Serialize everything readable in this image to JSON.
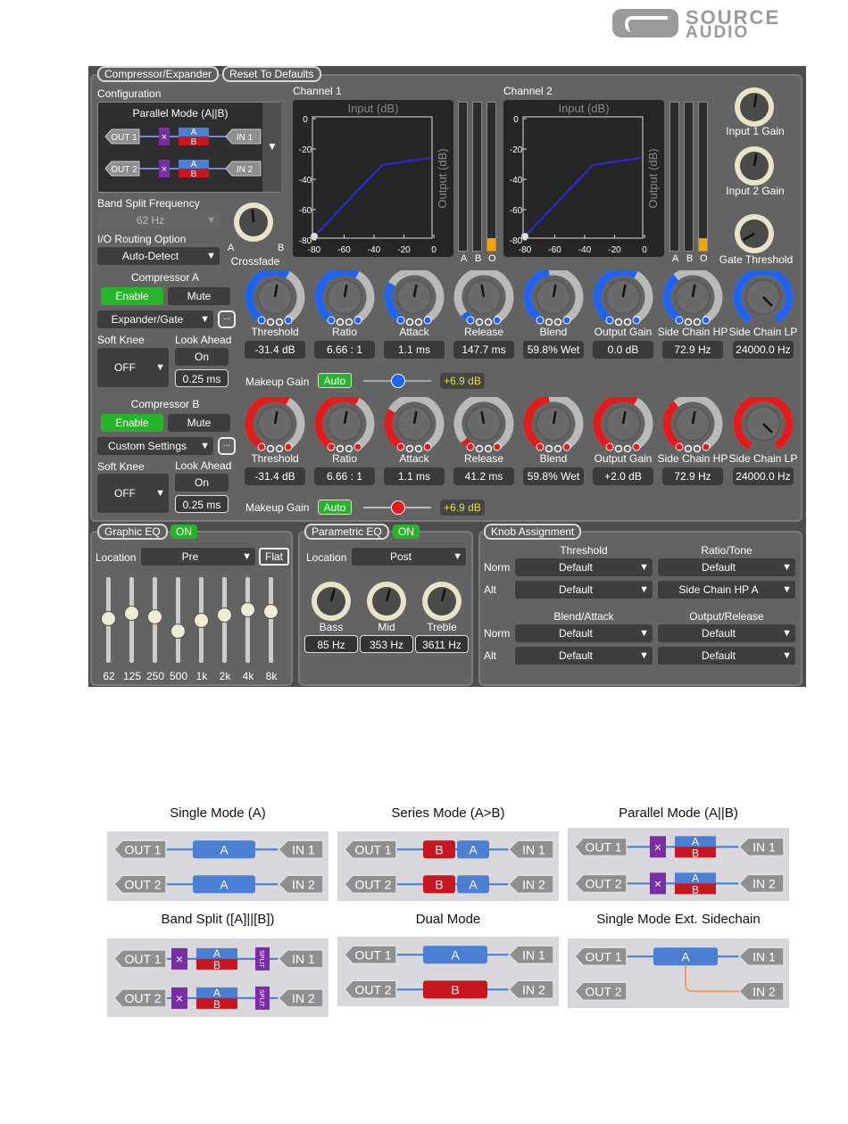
{
  "logo": {
    "line1": "SOURCE",
    "line2": "AUDIO"
  },
  "header": {
    "tab": "Compressor/Expander",
    "reset": "Reset To Defaults"
  },
  "config": {
    "label": "Configuration",
    "mode": "Parallel Mode (A||B)",
    "out1": "OUT 1",
    "out2": "OUT 2",
    "in1": "IN 1",
    "in2": "IN 2",
    "a": "A",
    "b": "B",
    "x": "×"
  },
  "bandsplit": {
    "label": "Band Split Frequency",
    "value": "62 Hz"
  },
  "crossfade": {
    "label": "Crossfade",
    "a": "A",
    "b": "B"
  },
  "routing": {
    "label": "I/O Routing Option",
    "value": "Auto-Detect"
  },
  "channels": [
    {
      "label": "Channel 1",
      "input": "Input (dB)",
      "output": "Output (dB)",
      "yt": [
        "0",
        "-20",
        "-40",
        "-60",
        "-80"
      ],
      "xt": [
        "-80",
        "-60",
        "-40",
        "-20",
        "0"
      ],
      "meters": [
        "A",
        "B",
        "O"
      ]
    },
    {
      "label": "Channel 2",
      "input": "Input (dB)",
      "output": "Output (dB)",
      "yt": [
        "0",
        "-20",
        "-40",
        "-60",
        "-80"
      ],
      "xt": [
        "-80",
        "-60",
        "-40",
        "-20",
        "0"
      ],
      "meters": [
        "A",
        "B",
        "O"
      ]
    }
  ],
  "rightknobs": [
    "Input 1 Gain",
    "Input 2 Gain",
    "Gate Threshold"
  ],
  "compA": {
    "title": "Compressor A",
    "enable": "Enable",
    "mute": "Mute",
    "type": "Expander/Gate",
    "more": "...",
    "softknee": "Soft Knee",
    "softknee_val": "OFF",
    "lookahead": "Look Ahead",
    "lookahead_on": "On",
    "lookahead_val": "0.25 ms",
    "makeup": "Makeup Gain",
    "auto": "Auto",
    "makeup_val": "+6.9 dB",
    "makeup_level": 0.51,
    "knobs": [
      {
        "label": "Threshold",
        "value": "-31.4 dB"
      },
      {
        "label": "Ratio",
        "value": "6.66 : 1"
      },
      {
        "label": "Attack",
        "value": "1.1 ms"
      },
      {
        "label": "Release",
        "value": "147.7 ms"
      },
      {
        "label": "Blend",
        "value": "59.8% Wet"
      },
      {
        "label": "Output Gain",
        "value": "0.0 dB"
      },
      {
        "label": "Side Chain HP",
        "value": "72.9 Hz"
      },
      {
        "label": "Side Chain LP",
        "value": "24000.0 Hz"
      }
    ]
  },
  "compB": {
    "title": "Compressor B",
    "enable": "Enable",
    "mute": "Mute",
    "type": "Custom Settings",
    "more": "...",
    "softknee": "Soft Knee",
    "softknee_val": "OFF",
    "lookahead": "Look Ahead",
    "lookahead_on": "On",
    "lookahead_val": "0.25 ms",
    "makeup": "Makeup Gain",
    "auto": "Auto",
    "makeup_val": "+6.9 dB",
    "makeup_level": 0.51,
    "knobs": [
      {
        "label": "Threshold",
        "value": "-31.4 dB"
      },
      {
        "label": "Ratio",
        "value": "6.66 : 1"
      },
      {
        "label": "Attack",
        "value": "1.1 ms"
      },
      {
        "label": "Release",
        "value": "41.2 ms"
      },
      {
        "label": "Blend",
        "value": "59.8% Wet"
      },
      {
        "label": "Output Gain",
        "value": "+2.0 dB"
      },
      {
        "label": "Side Chain HP",
        "value": "72.9 Hz"
      },
      {
        "label": "Side Chain LP",
        "value": "24000.0 Hz"
      }
    ]
  },
  "geq": {
    "title": "Graphic EQ",
    "on": "ON",
    "location_label": "Location",
    "location": "Pre",
    "flat": "Flat",
    "bands": [
      {
        "label": "62",
        "level": 0.52
      },
      {
        "label": "125",
        "level": 0.58
      },
      {
        "label": "250",
        "level": 0.54
      },
      {
        "label": "500",
        "level": 0.38
      },
      {
        "label": "1k",
        "level": 0.5
      },
      {
        "label": "2k",
        "level": 0.56
      },
      {
        "label": "4k",
        "level": 0.62
      },
      {
        "label": "8k",
        "level": 0.6
      }
    ]
  },
  "peq": {
    "title": "Parametric EQ",
    "on": "ON",
    "location_label": "Location",
    "location": "Post",
    "knobs": [
      {
        "label": "Bass",
        "value": "85 Hz"
      },
      {
        "label": "Mid",
        "value": "353 Hz"
      },
      {
        "label": "Treble",
        "value": "3611 Hz"
      }
    ]
  },
  "assign": {
    "title": "Knob Assignment",
    "norm": "Norm",
    "alt": "Alt",
    "groups": [
      {
        "title": "Threshold",
        "norm": "Default",
        "alt": "Default"
      },
      {
        "title": "Ratio/Tone",
        "norm": "Default",
        "alt": "Side Chain HP A"
      },
      {
        "title": "Blend/Attack",
        "norm": "Default",
        "alt": "Default"
      },
      {
        "title": "Output/Release",
        "norm": "Default",
        "alt": "Default"
      }
    ]
  },
  "modes": [
    {
      "caption": "Single Mode (A)",
      "kind": "single"
    },
    {
      "caption": "Series Mode (A>B)",
      "kind": "series"
    },
    {
      "caption": "Parallel Mode (A||B)",
      "kind": "parallel"
    },
    {
      "caption": "Band Split ([A]||[B])",
      "kind": "split"
    },
    {
      "caption": "Dual Mode",
      "kind": "dual"
    },
    {
      "caption": "Single Mode Ext. Sidechain",
      "kind": "ext"
    }
  ],
  "mode_labels": {
    "out1": "OUT 1",
    "out2": "OUT 2",
    "in1": "IN 1",
    "in2": "IN 2",
    "a": "A",
    "b": "B",
    "x": "×",
    "split": "SPLIT"
  },
  "colors": {
    "blue": "#1f63f0",
    "red": "#e21b1b",
    "green": "#27b32a",
    "panel": "#4d4d4d",
    "section": "#636363",
    "boxblue": "#4a7fd4",
    "boxred": "#c8161e",
    "purple": "#7a2ea3"
  }
}
